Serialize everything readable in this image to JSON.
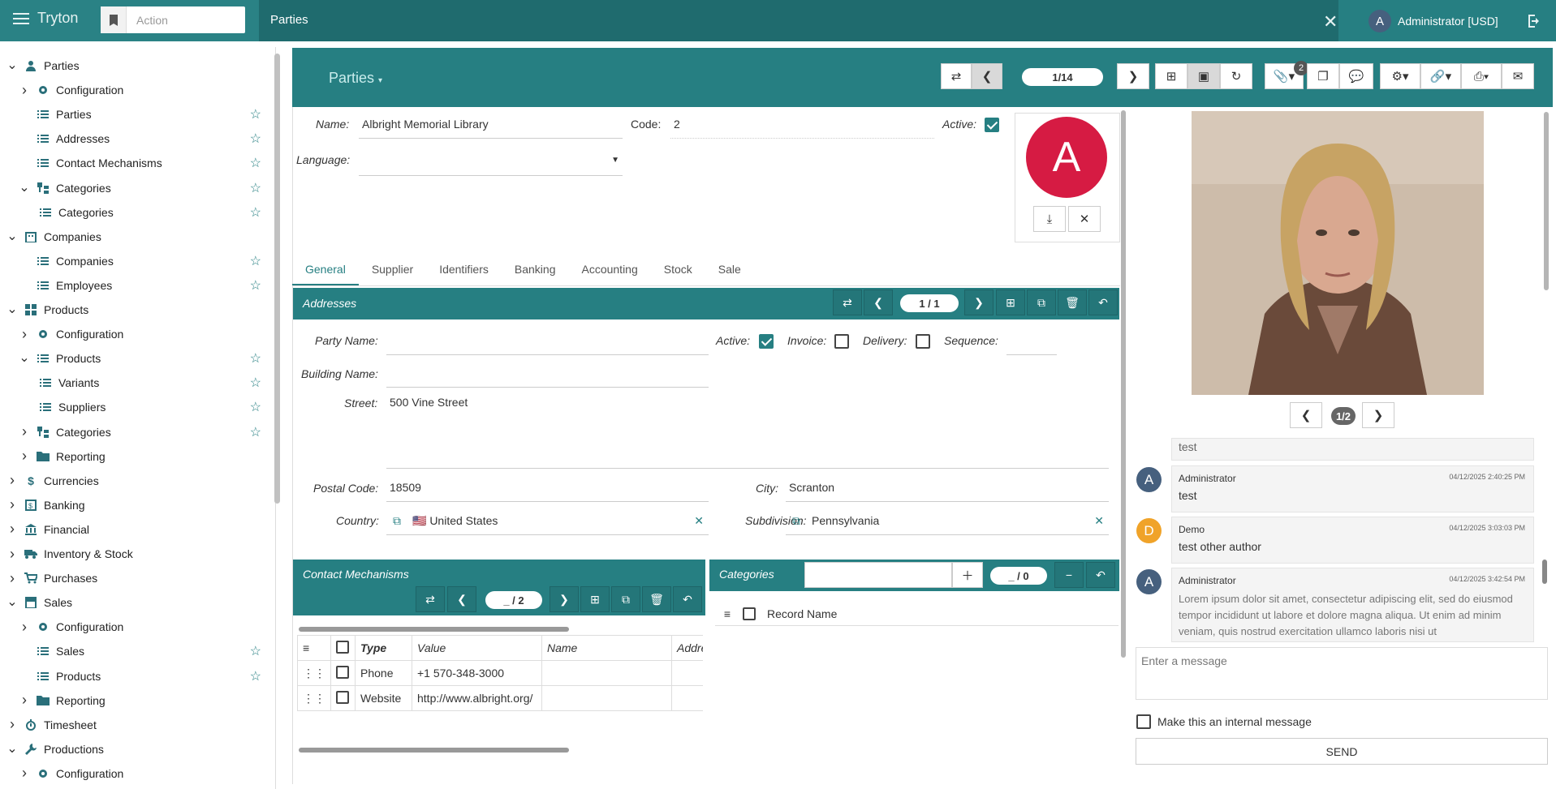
{
  "app": {
    "brand": "Tryton",
    "action_placeholder": "Action",
    "tab_title": "Parties",
    "user_label": "Administrator [USD]",
    "user_initial": "A"
  },
  "sidebar": {
    "items": [
      {
        "label": "Parties",
        "icon": "person-icon",
        "expander": "down",
        "level": 0
      },
      {
        "label": "Configuration",
        "icon": "gear-icon",
        "expander": "right",
        "level": 1
      },
      {
        "label": "Parties",
        "icon": "list-icon",
        "level": 1,
        "star": true
      },
      {
        "label": "Addresses",
        "icon": "list-icon",
        "level": 1,
        "star": true
      },
      {
        "label": "Contact Mechanisms",
        "icon": "list-icon",
        "level": 1,
        "star": true
      },
      {
        "label": "Categories",
        "icon": "tree-icon",
        "expander": "down",
        "level": 1,
        "star": true
      },
      {
        "label": "Categories",
        "icon": "list-icon",
        "level": 2,
        "star": true
      },
      {
        "label": "Companies",
        "icon": "building-icon",
        "expander": "down",
        "level": 0
      },
      {
        "label": "Companies",
        "icon": "list-icon",
        "level": 1,
        "star": true
      },
      {
        "label": "Employees",
        "icon": "list-icon",
        "level": 1,
        "star": true
      },
      {
        "label": "Products",
        "icon": "grid-icon",
        "expander": "down",
        "level": 0
      },
      {
        "label": "Configuration",
        "icon": "gear-icon",
        "expander": "right",
        "level": 1
      },
      {
        "label": "Products",
        "icon": "list-icon",
        "expander": "down",
        "level": 1,
        "star": true
      },
      {
        "label": "Variants",
        "icon": "list-icon",
        "level": 2,
        "star": true
      },
      {
        "label": "Suppliers",
        "icon": "list-icon",
        "level": 2,
        "star": true
      },
      {
        "label": "Categories",
        "icon": "tree-icon",
        "expander": "right",
        "level": 1,
        "star": true
      },
      {
        "label": "Reporting",
        "icon": "folder-icon",
        "expander": "right",
        "level": 1
      },
      {
        "label": "Currencies",
        "icon": "dollar-icon",
        "expander": "right",
        "level": 0
      },
      {
        "label": "Banking",
        "icon": "bank-card-icon",
        "expander": "right",
        "level": 0
      },
      {
        "label": "Financial",
        "icon": "bank-icon",
        "expander": "right",
        "level": 0
      },
      {
        "label": "Inventory & Stock",
        "icon": "truck-icon",
        "expander": "right",
        "level": 0
      },
      {
        "label": "Purchases",
        "icon": "cart-icon",
        "expander": "right",
        "level": 0
      },
      {
        "label": "Sales",
        "icon": "shop-icon",
        "expander": "down",
        "level": 0
      },
      {
        "label": "Configuration",
        "icon": "gear-icon",
        "expander": "right",
        "level": 1
      },
      {
        "label": "Sales",
        "icon": "list-icon",
        "level": 1,
        "star": true
      },
      {
        "label": "Products",
        "icon": "list-icon",
        "level": 1,
        "star": true
      },
      {
        "label": "Reporting",
        "icon": "folder-icon",
        "expander": "right",
        "level": 1
      },
      {
        "label": "Timesheet",
        "icon": "timer-icon",
        "expander": "right",
        "level": 0
      },
      {
        "label": "Productions",
        "icon": "wrench-icon",
        "expander": "down",
        "level": 0
      },
      {
        "label": "Configuration",
        "icon": "gear-icon",
        "expander": "right",
        "level": 1
      }
    ]
  },
  "form": {
    "title": "Parties",
    "pager": "1/14",
    "attachment_count": "2",
    "name_label": "Name:",
    "name_value": "Albright Memorial Library",
    "code_label": "Code:",
    "code_value": "2",
    "active_label": "Active:",
    "language_label": "Language:",
    "avatar_initial": "A",
    "tabs": [
      "General",
      "Supplier",
      "Identifiers",
      "Banking",
      "Accounting",
      "Stock",
      "Sale"
    ]
  },
  "addresses": {
    "title": "Addresses",
    "pager": "1 / 1",
    "party_name_label": "Party Name:",
    "active_label": "Active:",
    "invoice_label": "Invoice:",
    "delivery_label": "Delivery:",
    "sequence_label": "Sequence:",
    "building_label": "Building Name:",
    "street_label": "Street:",
    "street_value": "500 Vine Street",
    "postal_label": "Postal Code:",
    "postal_value": "18509",
    "city_label": "City:",
    "city_value": "Scranton",
    "country_label": "Country:",
    "country_value": "🇺🇸 United States",
    "subdivision_label": "Subdivision:",
    "subdivision_value": "Pennsylvania"
  },
  "contacts": {
    "title": "Contact Mechanisms",
    "pager": "_ / 2",
    "columns": [
      "Type",
      "Value",
      "Name",
      "Addre"
    ],
    "rows": [
      {
        "type": "Phone",
        "value": "+1 570-348-3000"
      },
      {
        "type": "Website",
        "value": "http://www.albright.org/"
      }
    ]
  },
  "categories": {
    "title": "Categories",
    "pager": "_ / 0",
    "column": "Record Name"
  },
  "right": {
    "image_pager": "1/2",
    "messages": [
      {
        "initial": "",
        "author": "",
        "date": "",
        "text": "test",
        "color": "#46607e"
      },
      {
        "initial": "A",
        "author": "Administrator",
        "date": "04/12/2025 2:40:25 PM",
        "text": "test",
        "color": "#46607e"
      },
      {
        "initial": "D",
        "author": "Demo",
        "date": "04/12/2025 3:03:03 PM",
        "text": "test other author",
        "color": "#f0a329"
      },
      {
        "initial": "A",
        "author": "Administrator",
        "date": "04/12/2025 3:42:54 PM",
        "text": "Lorem ipsum dolor sit amet, consectetur adipiscing elit, sed do eiusmod tempor incididunt ut labore et dolore magna aliqua. Ut enim ad minim veniam, quis nostrud exercitation ullamco laboris nisi ut",
        "color": "#46607e"
      }
    ],
    "message_placeholder": "Enter a message",
    "internal_label": "Make this an internal message",
    "send_label": "SEND"
  }
}
